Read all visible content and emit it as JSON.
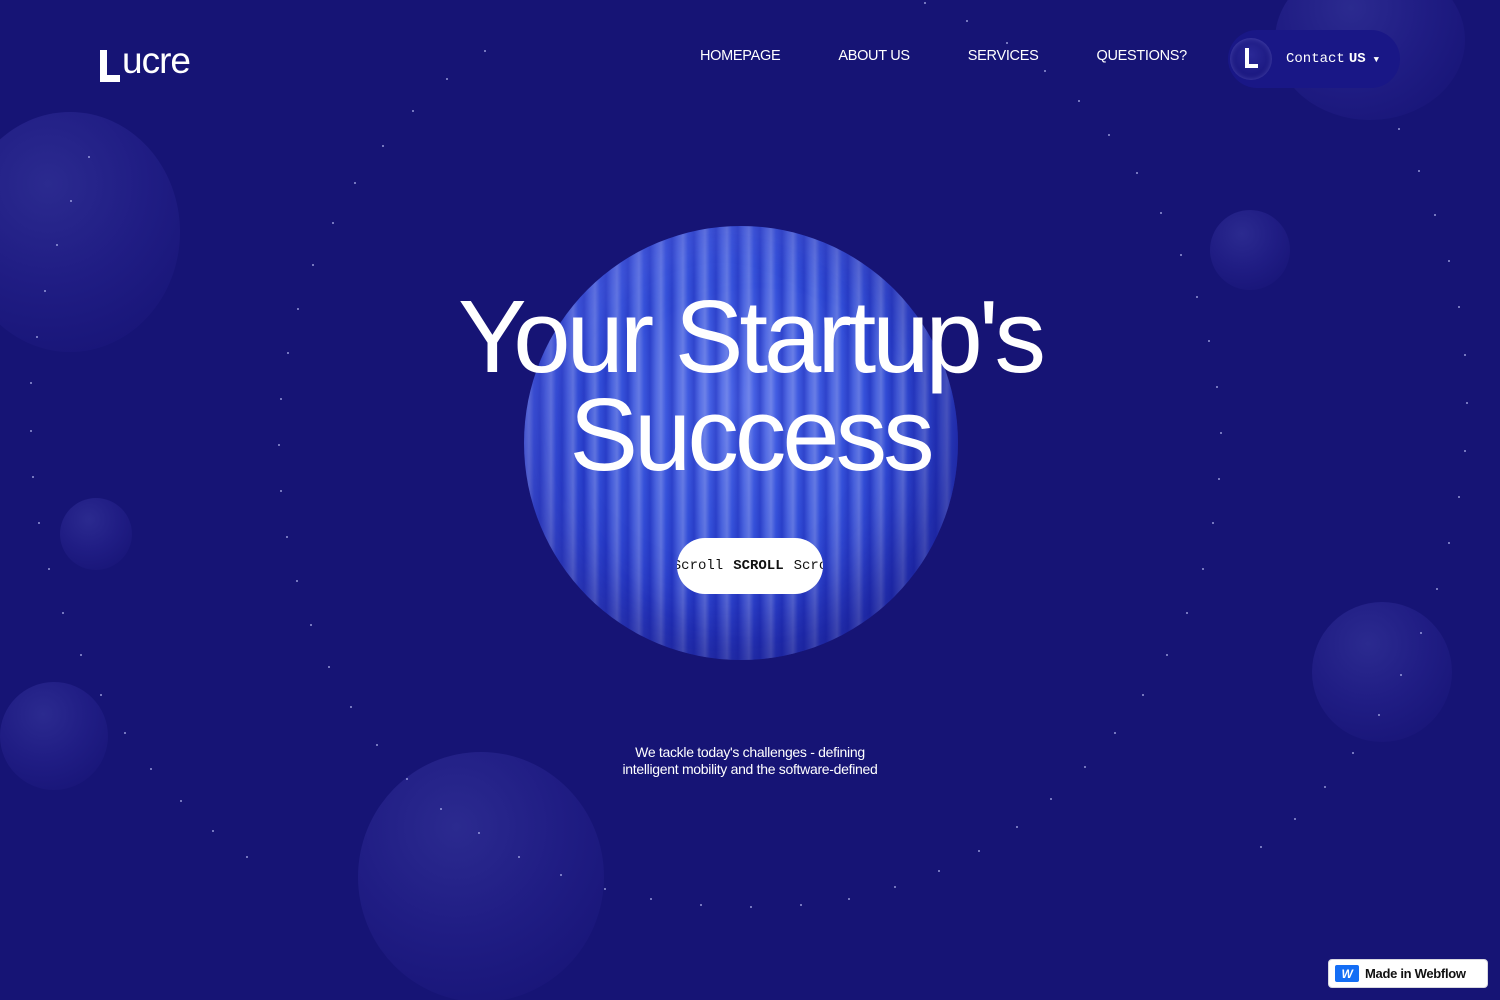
{
  "brand": {
    "logo_text": "ucre"
  },
  "nav": {
    "items": [
      {
        "label": "HOMEPAGE"
      },
      {
        "label": "ABOUT US"
      },
      {
        "label": "SERVICES"
      },
      {
        "label": "QUESTIONS?"
      }
    ]
  },
  "contact": {
    "label": "Contact",
    "label_bold": "US",
    "caret_icon": "caret-down-icon"
  },
  "hero": {
    "headline_line1": "Your Startup's",
    "headline_line2": "Success",
    "scroll_pill": {
      "left": "Scroll",
      "center": "SCROLL",
      "right": "Scro"
    },
    "tagline_line1": "We tackle today's challenges - defining",
    "tagline_line2": "intelligent mobility and the software-defined"
  },
  "badge": {
    "label": "Made in Webflow",
    "icon": "webflow-icon"
  },
  "colors": {
    "background": "#161475",
    "sphere": "#3450d9",
    "text": "#ffffff",
    "webflow_blue": "#146ef5"
  }
}
